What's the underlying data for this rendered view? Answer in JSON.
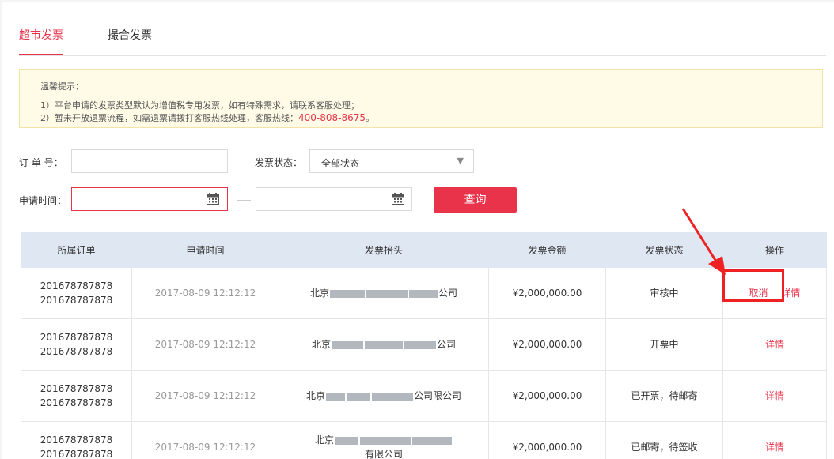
{
  "tabs": [
    {
      "label": "超市发票",
      "active": true
    },
    {
      "label": "撮合发票",
      "active": false
    }
  ],
  "notice": {
    "title": "温馨提示：",
    "line1": "1）平台申请的发票类型默认为增值税专用发票，如有特殊需求，请联系客服处理；",
    "line2_prefix": "2）暂未开放退票流程，如需退票请拨打客服热线处理，客服热线：",
    "hotline": "400-808-8675",
    "line2_suffix": "。"
  },
  "filters": {
    "order_label": "订 单 号：",
    "order_value": "",
    "status_label": "发票状态：",
    "status_value": "全部状态",
    "time_label": "申请时间：",
    "start_value": "",
    "end_value": "",
    "search_label": "查询"
  },
  "table": {
    "headers": [
      "所属订单",
      "申请时间",
      "发票抬头",
      "发票金额",
      "发票状态",
      "操作"
    ],
    "rows": [
      {
        "order1": "201678787878",
        "order2": "201678787878",
        "time": "2017-08-09 12:12:12",
        "head_prefix": "北京",
        "head_suffix": "公司",
        "head_suffix2": "",
        "amount": "¥2,000,000.00",
        "status": "审核中",
        "cancel": "取消",
        "detail": "详情"
      },
      {
        "order1": "201678787878",
        "order2": "201678787878",
        "time": "2017-08-09 12:12:12",
        "head_prefix": "北京",
        "head_suffix": "公司",
        "head_suffix2": "",
        "amount": "¥2,000,000.00",
        "status": "开票中",
        "cancel": "",
        "detail": "详情"
      },
      {
        "order1": "201678787878",
        "order2": "201678787878",
        "time": "2017-08-09 12:12:12",
        "head_prefix": "北京",
        "head_suffix": "公司限公司",
        "head_suffix2": "",
        "amount": "¥2,000,000.00",
        "status": "已开票，待邮寄",
        "cancel": "",
        "detail": "详情"
      },
      {
        "order1": "201678787878",
        "order2": "201678787878",
        "time": "2017-08-09 12:12:12",
        "head_prefix": "北京",
        "head_suffix": "",
        "head_suffix2": "有限公司",
        "amount": "¥2,000,000.00",
        "status": "已邮寄，待签收",
        "cancel": "",
        "detail": "详情"
      }
    ]
  },
  "icons": {
    "calendar": "calendar-icon",
    "dropdown": "caret-down-icon"
  },
  "colors": {
    "accent": "#e8334a",
    "notice_bg": "#fffbe6",
    "header_bg": "#dfe7f2",
    "annotation": "#ee2222"
  }
}
